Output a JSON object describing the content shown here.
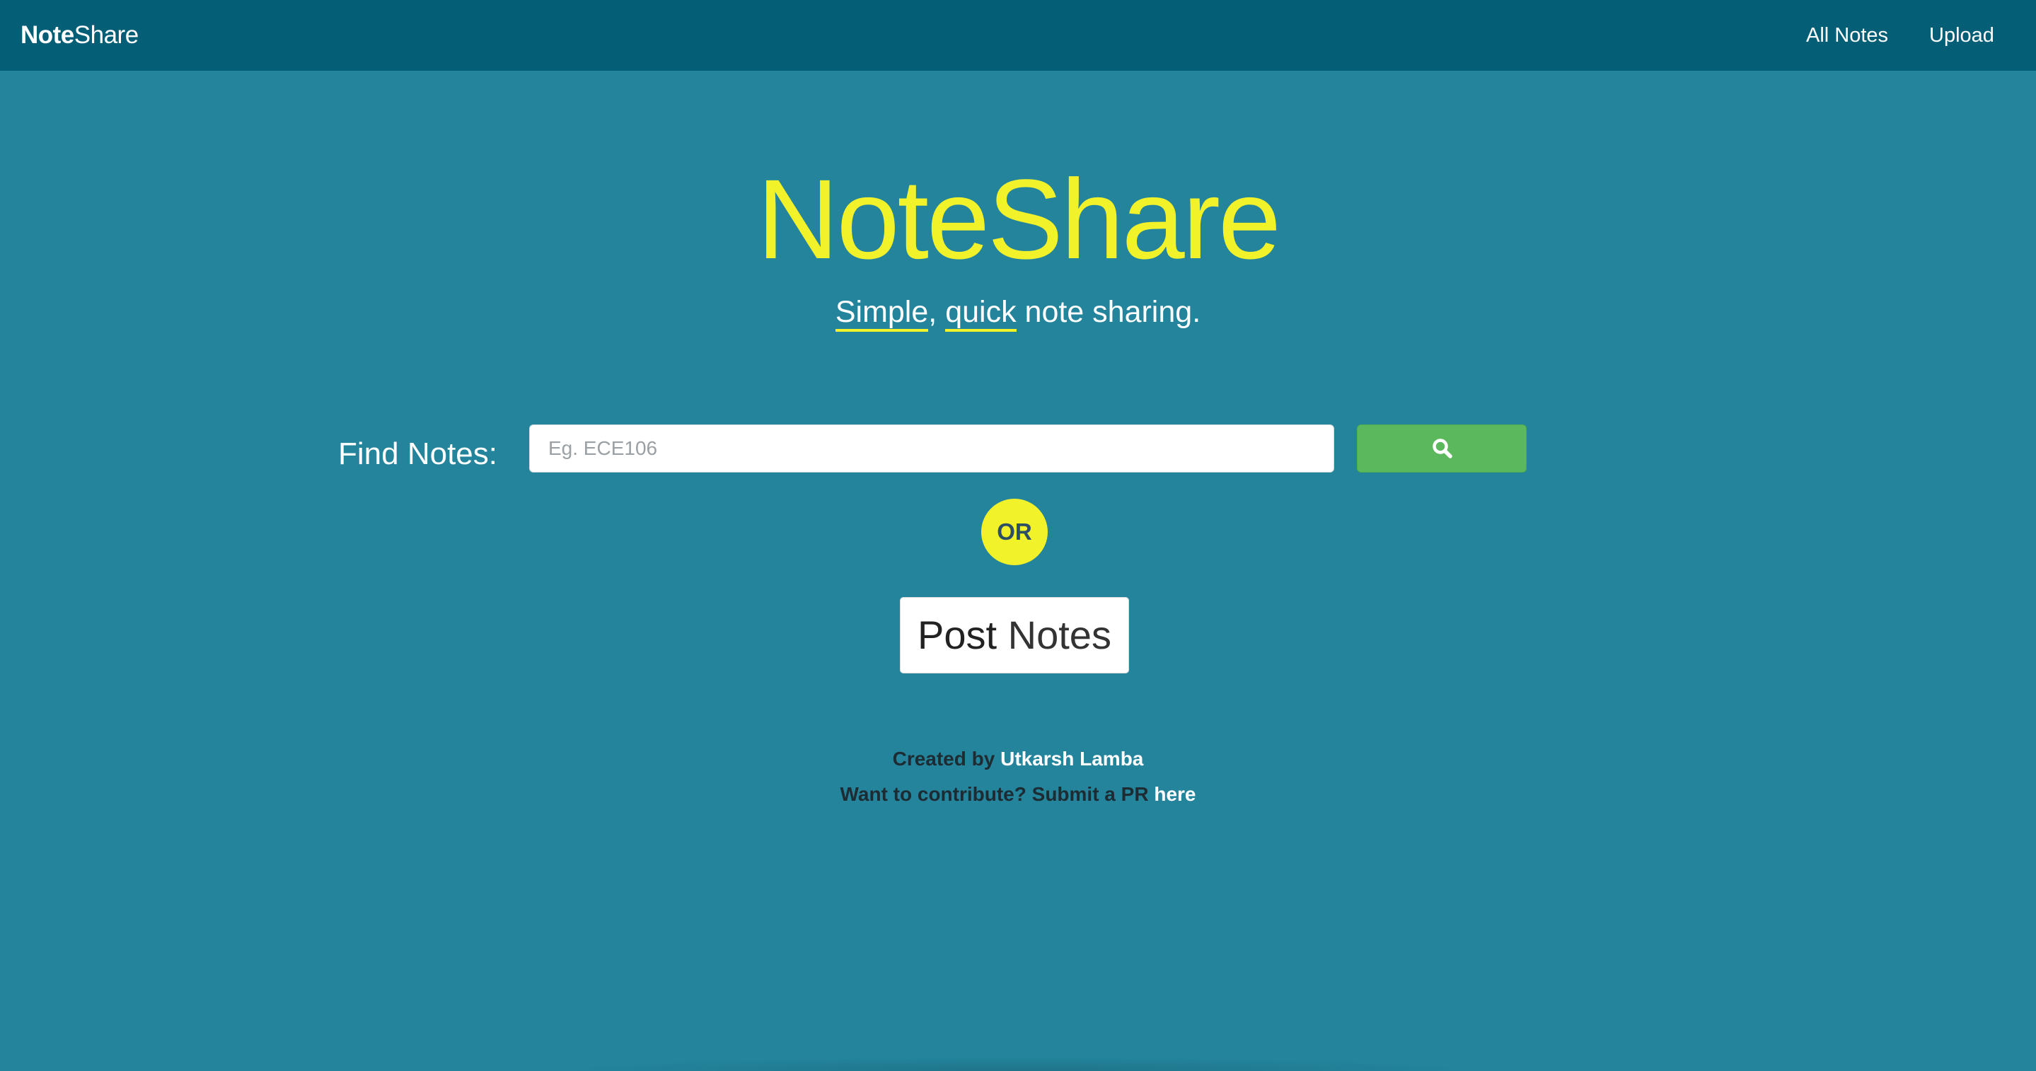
{
  "navbar": {
    "brand_bold": "Note",
    "brand_light": "Share",
    "links": [
      {
        "label": "All Notes"
      },
      {
        "label": "Upload"
      }
    ]
  },
  "hero": {
    "title_bold": "Note",
    "title_light": "Share",
    "tagline_word1": "Simple",
    "tagline_sep": ", ",
    "tagline_word2": "quick",
    "tagline_rest": " note sharing."
  },
  "search": {
    "label": "Find Notes:",
    "placeholder": "Eg. ECE106",
    "value": "",
    "button_icon": "search-icon"
  },
  "or_label": "OR",
  "post_button": {
    "bold": "Post",
    "light": " Notes"
  },
  "credits": {
    "line1_prefix": "Created by ",
    "author": "Utkarsh Lamba",
    "line2_prefix": "Want to contribute? Submit a PR ",
    "pr_link": "here"
  },
  "colors": {
    "background": "#23849c",
    "navbar": "#045f76",
    "accent_yellow": "#f2f22a",
    "search_button": "#5cb85c"
  }
}
